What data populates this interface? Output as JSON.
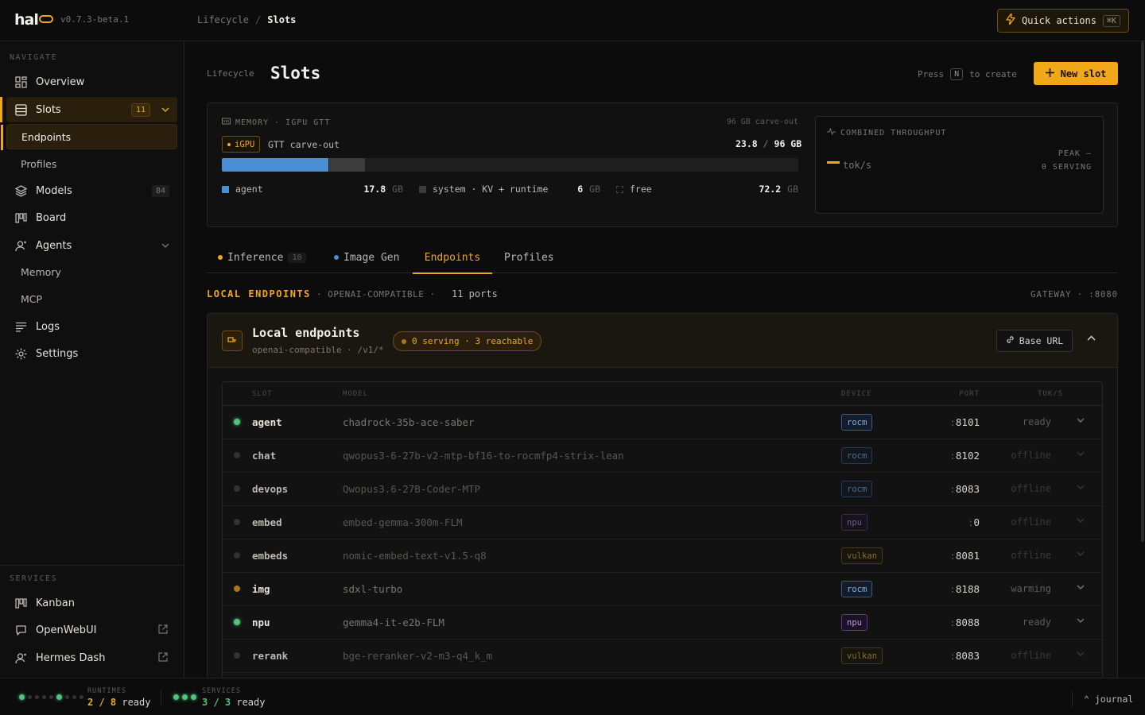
{
  "app": {
    "logo": "hal",
    "version": "v0.7.3-beta.1"
  },
  "breadcrumb": {
    "parent": "Lifecycle",
    "separator": "/",
    "current": "Slots"
  },
  "quick_actions": {
    "label": "Quick actions",
    "shortcut": "⌘K"
  },
  "sidebar": {
    "navigate_label": "NAVIGATE",
    "items": [
      {
        "label": "Overview",
        "icon": "grid-icon"
      },
      {
        "label": "Slots",
        "icon": "server-icon",
        "count": "11"
      },
      {
        "label": "Endpoints"
      },
      {
        "label": "Profiles"
      },
      {
        "label": "Models",
        "icon": "layers-icon",
        "count": "84"
      },
      {
        "label": "Board",
        "icon": "board-icon"
      },
      {
        "label": "Agents",
        "icon": "agent-icon"
      },
      {
        "label": "Memory"
      },
      {
        "label": "MCP"
      },
      {
        "label": "Logs",
        "icon": "logs-icon"
      },
      {
        "label": "Settings",
        "icon": "gear-icon"
      }
    ],
    "services_label": "SERVICES",
    "services": [
      {
        "label": "Kanban",
        "icon": "board-icon"
      },
      {
        "label": "OpenWebUI",
        "icon": "chat-icon"
      },
      {
        "label": "Hermes Dash",
        "icon": "agent-icon"
      }
    ]
  },
  "page": {
    "section": "Lifecycle",
    "title": "Slots",
    "press": "Press",
    "press_key": "N",
    "press_suffix": "to create",
    "new_slot": "New slot"
  },
  "memory": {
    "head": "MEMORY · IGPU GTT",
    "carveout": "96 GB carve-out",
    "badge": "iGPU",
    "label": "GTT carve-out",
    "used": "23.8",
    "total": "96 GB",
    "agent_fraction": 0.185,
    "system_fraction": 0.0625,
    "legend": [
      {
        "name": "agent",
        "value": "17.8",
        "unit": "GB",
        "color": "#4a8fd4"
      },
      {
        "name": "system · KV + runtime",
        "value": "6",
        "unit": "GB",
        "color": "#3c3c3c"
      },
      {
        "name": "free",
        "value": "72.2",
        "unit": "GB",
        "color": "#1e1e1e"
      }
    ]
  },
  "throughput": {
    "head": "COMBINED THROUGHPUT",
    "unit": "tok/s",
    "peak": "PEAK —",
    "serving": "0 SERVING"
  },
  "tabs": [
    {
      "label": "Inference",
      "count": "10",
      "dot": "#f0a818"
    },
    {
      "label": "Image Gen",
      "dot": "#4a8fd4"
    },
    {
      "label": "Endpoints"
    },
    {
      "label": "Profiles"
    }
  ],
  "local": {
    "head": "LOCAL ENDPOINTS",
    "sub": "· OPENAI-COMPATIBLE ·",
    "ports": "11 ports",
    "gateway": "GATEWAY · :8080"
  },
  "endpoint_card": {
    "title": "Local endpoints",
    "sub": "openai-compatible · /v1/*",
    "pill": "0 serving · 3 reachable",
    "base_url": "Base URL"
  },
  "table": {
    "headers": [
      "SLOT",
      "MODEL",
      "DEVICE",
      "PORT",
      "TOK/S"
    ],
    "rows": [
      {
        "slot": "agent",
        "model": "chadrock-35b-ace-saber",
        "device": "rocm",
        "port": "8101",
        "tok": "ready",
        "status": "ready"
      },
      {
        "slot": "chat",
        "model": "qwopus3-6-27b-v2-mtp-bf16-to-rocmfp4-strix-lean",
        "device": "rocm",
        "port": "8102",
        "tok": "offline",
        "status": "offline"
      },
      {
        "slot": "devops",
        "model": "Qwopus3.6-27B-Coder-MTP",
        "device": "rocm",
        "port": "8083",
        "tok": "offline",
        "status": "offline"
      },
      {
        "slot": "embed",
        "model": "embed-gemma-300m-FLM",
        "device": "npu",
        "port": "0",
        "tok": "offline",
        "status": "offline"
      },
      {
        "slot": "embeds",
        "model": "nomic-embed-text-v1.5-q8",
        "device": "vulkan",
        "port": "8081",
        "tok": "offline",
        "status": "offline"
      },
      {
        "slot": "img",
        "model": "sdxl-turbo",
        "device": "rocm",
        "port": "8188",
        "tok": "warming",
        "status": "warming"
      },
      {
        "slot": "npu",
        "model": "gemma4-it-e2b-FLM",
        "device": "npu",
        "port": "8088",
        "tok": "ready",
        "status": "ready"
      },
      {
        "slot": "rerank",
        "model": "bge-reranker-v2-m3-q4_k_m",
        "device": "vulkan",
        "port": "8083",
        "tok": "offline",
        "status": "offline"
      }
    ]
  },
  "footer": {
    "runtimes_label": "RUNTIMES",
    "runtimes_ready": "2 / 8",
    "services_label": "SERVICES",
    "services_ready": "3 / 3",
    "ready": "ready",
    "journal": "⌃ journal"
  },
  "colors": {
    "accent": "#f0a818",
    "ready": "#4fc47a",
    "warming": "#a8781a",
    "offline": "#3a3a3a"
  }
}
